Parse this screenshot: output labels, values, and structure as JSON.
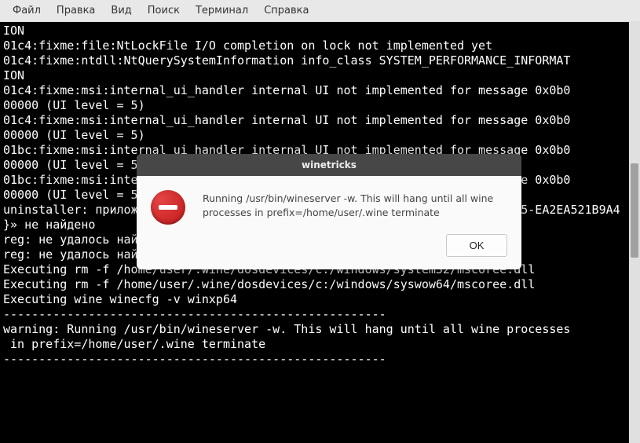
{
  "menubar": {
    "items": [
      {
        "label": "Файл"
      },
      {
        "label": "Правка"
      },
      {
        "label": "Вид"
      },
      {
        "label": "Поиск"
      },
      {
        "label": "Терминал"
      },
      {
        "label": "Справка"
      }
    ]
  },
  "terminal": {
    "lines": [
      "ION",
      "01c4:fixme:file:NtLockFile I/O completion on lock not implemented yet",
      "01c4:fixme:ntdll:NtQuerySystemInformation info_class SYSTEM_PERFORMANCE_INFORMAT",
      "ION",
      "01c4:fixme:msi:internal_ui_handler internal UI not implemented for message 0x0b0",
      "00000 (UI level = 5)",
      "01c4:fixme:msi:internal_ui_handler internal UI not implemented for message 0x0b0",
      "00000 (UI level = 5)",
      "01bc:fixme:msi:internal_ui_handler internal UI not implemented for message 0x0b0",
      "00000 (UI level = 5)",
      "01bc:fixme:msi:internal_ui_handler internal UI not implemented for message 0x0b0",
      "00000 (UI level = 5)",
      "uninstaller: приложение с GUID «{E2803110-78B3-4664-A479-3611A381656A}» 05-EA2EA521B9A4",
      "}» не найдено",
      "reg: не удалось найти указанный ключ",
      "reg: не удалось найти указанный ключ",
      "Executing rm -f /home/user/.wine/dosdevices/c:/windows/system32/mscoree.dll",
      "Executing rm -f /home/user/.wine/dosdevices/c:/windows/syswow64/mscoree.dll",
      "Executing wine winecfg -v winxp64",
      "------------------------------------------------------",
      "warning: Running /usr/bin/wineserver -w. This will hang until all wine processes",
      " in prefix=/home/user/.wine terminate",
      "------------------------------------------------------"
    ]
  },
  "dialog": {
    "title": "winetricks",
    "message": "Running /usr/bin/wineserver -w. This will hang until all wine processes in prefix=/home/user/.wine terminate",
    "ok_label": "OK",
    "icon_name": "error-icon"
  }
}
